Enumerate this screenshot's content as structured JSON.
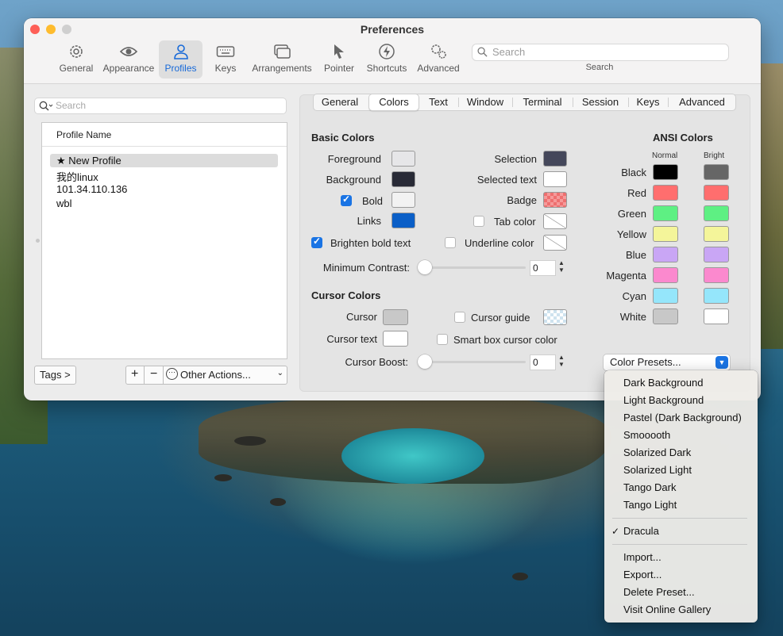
{
  "window": {
    "title": "Preferences"
  },
  "toolbar": {
    "items": [
      {
        "label": "General",
        "icon": "gear-icon"
      },
      {
        "label": "Appearance",
        "icon": "eye-icon"
      },
      {
        "label": "Profiles",
        "icon": "person-icon",
        "selected": true
      },
      {
        "label": "Keys",
        "icon": "keyboard-icon"
      },
      {
        "label": "Arrangements",
        "icon": "windows-icon"
      },
      {
        "label": "Pointer",
        "icon": "pointer-icon"
      },
      {
        "label": "Shortcuts",
        "icon": "bolt-icon"
      },
      {
        "label": "Advanced",
        "icon": "gears-icon"
      }
    ],
    "search_placeholder": "Search",
    "search_label": "Search"
  },
  "profiles": {
    "search_placeholder": "Search",
    "column_header": "Profile Name",
    "items": [
      "★ New Profile",
      "我的linux",
      "101.34.110.136",
      "wbl"
    ],
    "selected_index": 0,
    "tags_button": "Tags >",
    "add_button": "+",
    "remove_button": "−",
    "other_actions": "Other Actions..."
  },
  "tabs": [
    "General",
    "Colors",
    "Text",
    "Window",
    "Terminal",
    "Session",
    "Keys",
    "Advanced"
  ],
  "selected_tab": "Colors",
  "basic_colors": {
    "heading": "Basic Colors",
    "foreground": {
      "label": "Foreground",
      "color": "#e6e6e8"
    },
    "background": {
      "label": "Background",
      "color": "#282a36"
    },
    "bold": {
      "label": "Bold",
      "checked": true,
      "color": "#f2f2f2"
    },
    "links": {
      "label": "Links",
      "color": "#0b5fc7"
    },
    "brighten_bold": {
      "label": "Brighten bold text",
      "checked": true
    },
    "selection": {
      "label": "Selection",
      "color": "#44475a"
    },
    "selected_text": {
      "label": "Selected text",
      "color": "#ffffff"
    },
    "badge": {
      "label": "Badge",
      "color": "#ee6f6f"
    },
    "tab_color": {
      "label": "Tab color",
      "checked": false
    },
    "underline_color": {
      "label": "Underline color",
      "checked": false
    },
    "min_contrast": {
      "label": "Minimum Contrast:",
      "value": "0"
    }
  },
  "cursor_colors": {
    "heading": "Cursor Colors",
    "cursor": {
      "label": "Cursor",
      "color": "#c8c8c8"
    },
    "cursor_text": {
      "label": "Cursor text",
      "color": "#ffffff"
    },
    "cursor_guide": {
      "label": "Cursor guide",
      "checked": false
    },
    "smart_box": {
      "label": "Smart box cursor color",
      "checked": false
    },
    "cursor_boost": {
      "label": "Cursor Boost:",
      "value": "0"
    }
  },
  "ansi": {
    "heading": "ANSI Colors",
    "normal_label": "Normal",
    "bright_label": "Bright",
    "rows": [
      {
        "name": "Black",
        "normal": "#000000",
        "bright": "#666666"
      },
      {
        "name": "Red",
        "normal": "#ff6e6e",
        "bright": "#ff6e6e"
      },
      {
        "name": "Green",
        "normal": "#5ef083",
        "bright": "#5ef083"
      },
      {
        "name": "Yellow",
        "normal": "#f4f59a",
        "bright": "#f4f59a"
      },
      {
        "name": "Blue",
        "normal": "#c9a6f5",
        "bright": "#c9a6f5"
      },
      {
        "name": "Magenta",
        "normal": "#fb89ce",
        "bright": "#fb89ce"
      },
      {
        "name": "Cyan",
        "normal": "#95e6fb",
        "bright": "#95e6fb"
      },
      {
        "name": "White",
        "normal": "#c8c8c8",
        "bright": "#ffffff"
      }
    ]
  },
  "presets": {
    "button_label": "Color Presets...",
    "menu_items": [
      "Dark Background",
      "Light Background",
      "Pastel (Dark Background)",
      "Smooooth",
      "Solarized Dark",
      "Solarized Light",
      "Tango Dark",
      "Tango Light"
    ],
    "checked_item": "Dracula",
    "action_items": [
      "Import...",
      "Export...",
      "Delete Preset...",
      "Visit Online Gallery"
    ]
  }
}
